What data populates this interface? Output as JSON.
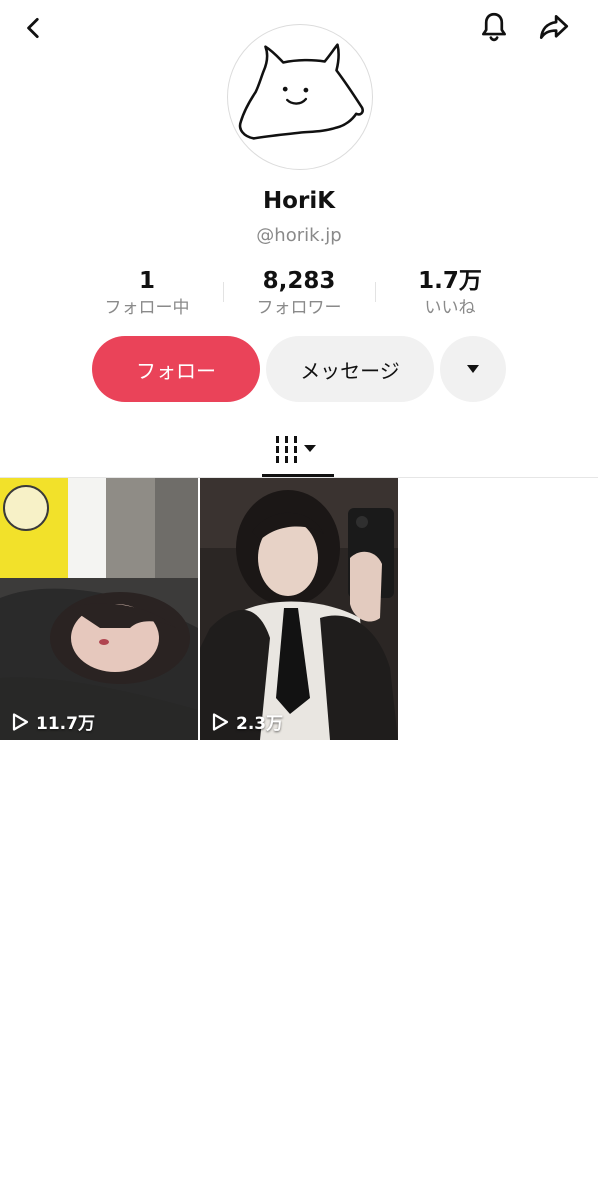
{
  "profile": {
    "display_name": "HoriK",
    "handle": "@horik.jp"
  },
  "stats": [
    {
      "value": "1",
      "label": "フォロー中"
    },
    {
      "value": "8,283",
      "label": "フォロワー"
    },
    {
      "value": "1.7万",
      "label": "いいね"
    }
  ],
  "actions": {
    "follow_label": "フォロー",
    "message_label": "メッセージ"
  },
  "videos": [
    {
      "views": "11.7万"
    },
    {
      "views": "2.3万"
    }
  ],
  "colors": {
    "follow_button": "#ea4359",
    "secondary_button": "#f1f1f1",
    "muted_text": "#8a8a8a"
  },
  "icons": [
    "back-arrow-icon",
    "bell-icon",
    "share-arrow-icon",
    "caret-down-icon",
    "grid-icon",
    "play-icon"
  ]
}
